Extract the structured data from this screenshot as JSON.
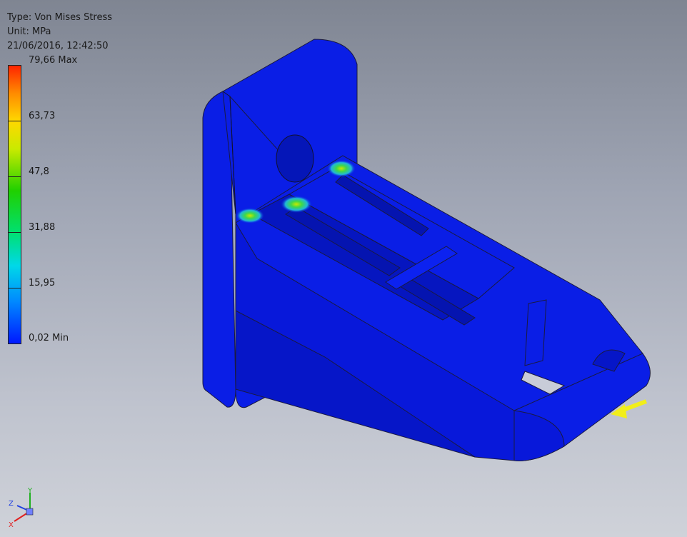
{
  "analysis": {
    "type_label": "Type: Von Mises Stress",
    "unit_label": "Unit: MPa",
    "timestamp": "21/06/2016, 12:42:50"
  },
  "legend": {
    "levels": [
      {
        "label": "79,66 Max",
        "value": 79.66
      },
      {
        "label": "63,73",
        "value": 63.73
      },
      {
        "label": "47,8",
        "value": 47.8
      },
      {
        "label": "31,88",
        "value": 31.88
      },
      {
        "label": "15,95",
        "value": 15.95
      },
      {
        "label": "0,02 Min",
        "value": 0.02
      }
    ]
  },
  "axes": {
    "y_label": "Y",
    "z_label": "Z",
    "x_label": "X"
  },
  "colors": {
    "part_blue": "#0a1ee6",
    "part_blue_dark": "#0616c8",
    "stress_green": "#3fd84a",
    "stress_yellow": "#d8e000",
    "load_arrow": "#f2ee1a",
    "axis_x": "#e02020",
    "axis_y": "#20b020",
    "axis_z": "#2040e0"
  },
  "icons": {
    "load_arrow": "load-arrow-icon",
    "axis_triad": "axis-triad-icon"
  }
}
